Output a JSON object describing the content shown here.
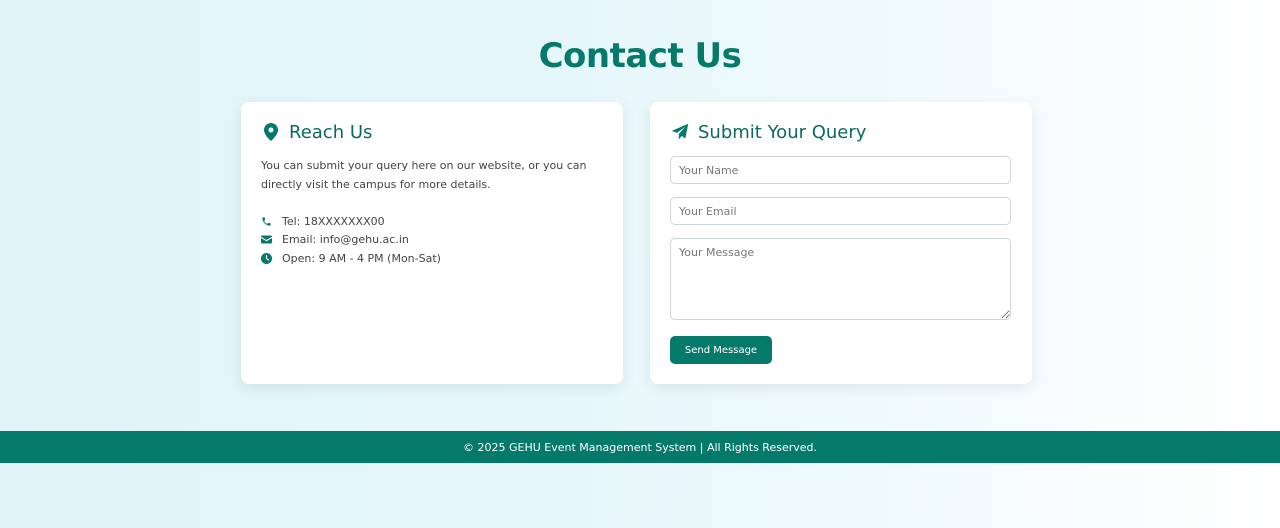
{
  "page": {
    "title": "Contact Us"
  },
  "reach": {
    "icon": "map-pin-icon",
    "title": "Reach Us",
    "description": "You can submit your query here on our website, or you can directly visit the campus for more details.",
    "items": [
      {
        "icon": "phone-icon",
        "text": "Tel: 18XXXXXXX00"
      },
      {
        "icon": "mail-icon",
        "text": "Email: info@gehu.ac.in"
      },
      {
        "icon": "clock-icon",
        "text": "Open: 9 AM - 4 PM (Mon-Sat)"
      }
    ]
  },
  "query": {
    "icon": "paper-plane-icon",
    "title": "Submit Your Query",
    "name_placeholder": "Your Name",
    "email_placeholder": "Your Email",
    "message_placeholder": "Your Message",
    "send_label": "Send Message"
  },
  "footer": {
    "text": "© 2025 GEHU Event Management System | All Rights Reserved."
  },
  "colors": {
    "accent": "#057a6b",
    "title": "#0a6a5f"
  }
}
